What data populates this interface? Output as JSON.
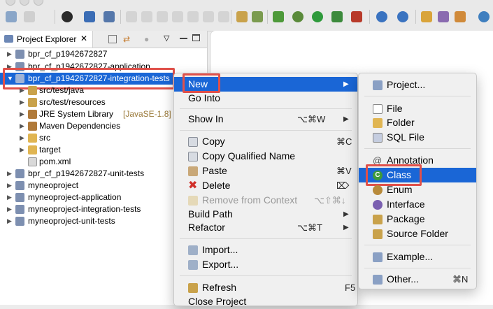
{
  "explorer": {
    "tab_title": "Project Explorer",
    "tree": [
      {
        "label": "bpr_cf_p1942672827"
      },
      {
        "label": "bpr_cf_p1942672827-application"
      },
      {
        "label": "bpr_cf_p1942672827-integration-tests"
      },
      {
        "label": "src/test/java"
      },
      {
        "label": "src/test/resources"
      },
      {
        "label": "JRE System Library",
        "suffix": "[JavaSE-1.8]"
      },
      {
        "label": "Maven Dependencies"
      },
      {
        "label": "src"
      },
      {
        "label": "target"
      },
      {
        "label": "pom.xml"
      },
      {
        "label": "bpr_cf_p1942672827-unit-tests"
      },
      {
        "label": "myneoproject"
      },
      {
        "label": "myneoproject-application"
      },
      {
        "label": "myneoproject-integration-tests"
      },
      {
        "label": "myneoproject-unit-tests"
      }
    ]
  },
  "context_menu": {
    "items": [
      {
        "label": "New",
        "shortcut": ""
      },
      {
        "label": "Go Into",
        "shortcut": ""
      },
      {
        "label": "Show In",
        "shortcut": "⌥⌘W"
      },
      {
        "label": "Copy",
        "shortcut": "⌘C"
      },
      {
        "label": "Copy Qualified Name",
        "shortcut": ""
      },
      {
        "label": "Paste",
        "shortcut": "⌘V"
      },
      {
        "label": "Delete",
        "shortcut": "⌦"
      },
      {
        "label": "Remove from Context",
        "shortcut": "⌥⇧⌘↓"
      },
      {
        "label": "Build Path",
        "shortcut": ""
      },
      {
        "label": "Refactor",
        "shortcut": "⌥⌘T"
      },
      {
        "label": "Import...",
        "shortcut": ""
      },
      {
        "label": "Export...",
        "shortcut": ""
      },
      {
        "label": "Refresh",
        "shortcut": "F5"
      },
      {
        "label": "Close Project",
        "shortcut": ""
      }
    ]
  },
  "submenu": {
    "items": [
      {
        "label": "Project...",
        "shortcut": ""
      },
      {
        "label": "File",
        "shortcut": ""
      },
      {
        "label": "Folder",
        "shortcut": ""
      },
      {
        "label": "SQL File",
        "shortcut": ""
      },
      {
        "label": "Annotation",
        "shortcut": ""
      },
      {
        "label": "Class",
        "shortcut": ""
      },
      {
        "label": "Enum",
        "shortcut": ""
      },
      {
        "label": "Interface",
        "shortcut": ""
      },
      {
        "label": "Package",
        "shortcut": ""
      },
      {
        "label": "Source Folder",
        "shortcut": ""
      },
      {
        "label": "Example...",
        "shortcut": ""
      },
      {
        "label": "Other...",
        "shortcut": "⌘N"
      }
    ]
  },
  "colors": {
    "selection": "#1a66d6",
    "highlight_box": "#e0504a"
  }
}
